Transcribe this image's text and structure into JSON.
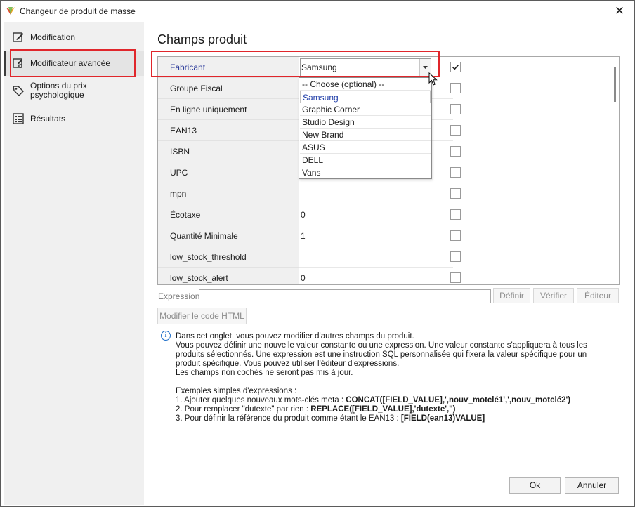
{
  "window": {
    "title": "Changeur de produit de masse",
    "close_glyph": "✕"
  },
  "colors": {
    "highlight": "#e0262b",
    "selected_text": "#2b3a9a",
    "info_icon": "#1f6fc9",
    "sidebar_bg": "#f0f0f0"
  },
  "sidebar": {
    "items": [
      {
        "label": "Modification",
        "icon": "edit-icon"
      },
      {
        "label": "Modificateur avancée",
        "icon": "advanced-edit-icon",
        "active": true
      },
      {
        "label": "Options du prix psychologique",
        "icon": "price-tag-icon"
      },
      {
        "label": "Résultats",
        "icon": "results-list-icon"
      }
    ]
  },
  "main": {
    "title": "Champs produit",
    "grid": {
      "rows": [
        {
          "name": "Fabricant",
          "value": "Samsung",
          "checked": true
        },
        {
          "name": "Groupe Fiscal",
          "value": "",
          "checked": false
        },
        {
          "name": "En ligne uniquement",
          "value": "",
          "checked": false
        },
        {
          "name": "EAN13",
          "value": "",
          "checked": false
        },
        {
          "name": "ISBN",
          "value": "",
          "checked": false
        },
        {
          "name": "UPC",
          "value": "",
          "checked": false
        },
        {
          "name": "mpn",
          "value": "",
          "checked": false
        },
        {
          "name": "Écotaxe",
          "value": "0",
          "checked": false
        },
        {
          "name": "Quantité Minimale",
          "value": "1",
          "checked": false
        },
        {
          "name": "low_stock_threshold",
          "value": "",
          "checked": false
        },
        {
          "name": "low_stock_alert",
          "value": "0",
          "checked": false
        }
      ]
    },
    "dropdown": {
      "options": [
        "-- Choose (optional) --",
        "Samsung",
        "Graphic Corner",
        "Studio Design",
        "New Brand",
        "ASUS",
        "DELL",
        "Vans"
      ],
      "selected": "Samsung"
    },
    "expression": {
      "label": "Expression",
      "value": "",
      "define_label": "Définir",
      "verify_label": "Vérifier",
      "editor_label": "Éditeur"
    },
    "html_button_label": "Modifier le code HTML",
    "info": {
      "line1": "Dans cet onglet, vous pouvez modifier d'autres champs du produit.",
      "line2": "Vous pouvez définir une nouvelle valeur constante ou une expression. Une valeur constante s'appliquera à tous les produits sélectionnés. Une expression est une instruction SQL personnalisée qui fixera la valeur spécifique pour un produit spécifique. Vous pouvez utiliser l'éditeur d'expressions.",
      "line3": "Les champs non cochés ne seront pas mis à jour.",
      "examples_title": "Exemples simples d'expressions :",
      "ex1_text": "1. Ajouter quelques nouveaux mots-clés meta : ",
      "ex1_code": "CONCAT([FIELD_VALUE],',nouv_motclé1',',nouv_motclé2')",
      "ex2_text": "2. Pour remplacer \"dutexte\" par rien : ",
      "ex2_code": "REPLACE([FIELD_VALUE],'dutexte','')",
      "ex3_text": "3. Pour définir la référence du produit comme étant le EAN13 : ",
      "ex3_code": "[FIELD(ean13)VALUE]"
    }
  },
  "footer": {
    "ok_label": "Ok",
    "cancel_label": "Annuler"
  }
}
